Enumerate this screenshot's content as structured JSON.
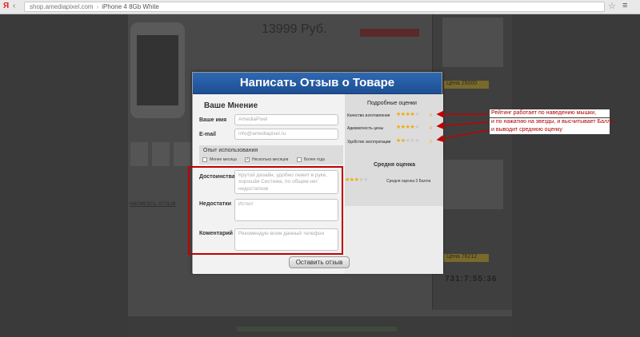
{
  "browser": {
    "yandex_logo": "Я",
    "url_site": "shop.amediapixel.com",
    "tab_title": "iPhone 4 8Gb White"
  },
  "background": {
    "price": "13999 Руб.",
    "write_review_link": "написать отзыв",
    "right_tag_1": "Цена 25000",
    "right_tag_2": "Цена 76212",
    "timer": "731:7:55:36"
  },
  "modal": {
    "title": "Написать Отзыв о Товаре",
    "opinion_title": "Ваше Мнение",
    "name_label": "Ваше имя",
    "name_value": "AmediaPixel",
    "email_label": "E-mail",
    "email_value": "info@amediapixel.ru",
    "usage_title": "Опыт использования",
    "usage_options": [
      "Менее месяца",
      "Несколько месяцев",
      "Более года"
    ],
    "pros_label": "Достоинства",
    "pros_value": "Крутой дизайн, удобно лежит в руке, хороша́я Система, по общем нет недостатков",
    "cons_label": "Недостатки",
    "cons_value": "Истют",
    "comment_label": "Коментарий",
    "comment_value": "Рекомендую всем данный телефон",
    "submit_label": "Оставить отзыв",
    "ratings_title": "Подробные оценки",
    "ratings": [
      {
        "label": "Качество изготовления",
        "score": 4
      },
      {
        "label": "Адекватность цены",
        "score": 4
      },
      {
        "label": "Удобство эксплуатации",
        "score": 2
      }
    ],
    "avg_title": "Средня оценка",
    "avg_score": 3,
    "avg_text": "Средня оценка 3 Балла"
  },
  "annotations": {
    "notes": [
      "Рейтинг работает по наведению мышки,",
      "и по нажатию на звезды, и высчитывает Баллы",
      "и выводит среднюю оценку"
    ]
  },
  "colors": {
    "header_blue": "#2f69b3",
    "star_on": "#f4a800",
    "annotation_red": "#c20000"
  }
}
